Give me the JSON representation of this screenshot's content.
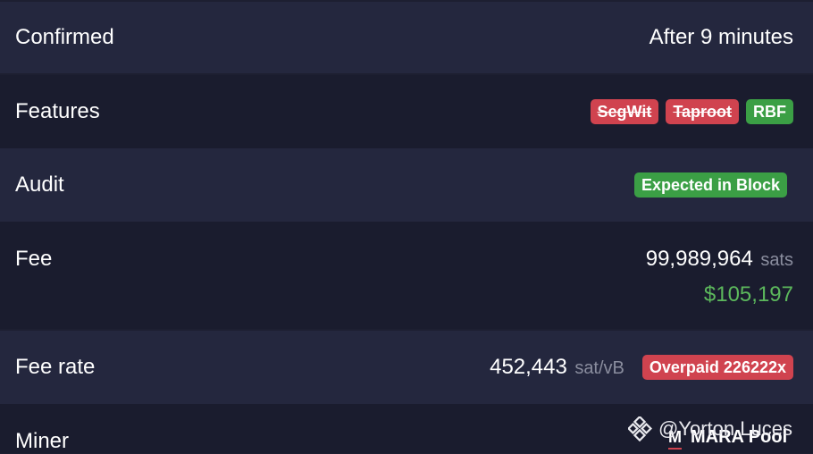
{
  "rows": {
    "confirmed": {
      "label": "Confirmed",
      "value": "After 9 minutes"
    },
    "features": {
      "label": "Features",
      "badges": [
        {
          "text": "SegWit",
          "status": "unsupported"
        },
        {
          "text": "Taproot",
          "status": "unsupported"
        },
        {
          "text": "RBF",
          "status": "supported"
        }
      ]
    },
    "audit": {
      "label": "Audit",
      "badge": "Expected in Block"
    },
    "fee": {
      "label": "Fee",
      "amount": "99,989,964",
      "unit": "sats",
      "fiat": "$105,197"
    },
    "fee_rate": {
      "label": "Fee rate",
      "amount": "452,443",
      "unit": "sat/vB",
      "badge": "Overpaid 226222x"
    },
    "miner": {
      "label": "Miner",
      "name": "MARA Pool",
      "logo_text": "M"
    }
  },
  "watermark": {
    "text": "@Yorton Luces",
    "icon": "binance-diamond-icon"
  },
  "colors": {
    "red_badge": "#d0434f",
    "green_badge": "#3b9f45",
    "fiat_green": "#5cb85c",
    "muted": "#8a8d9e"
  }
}
